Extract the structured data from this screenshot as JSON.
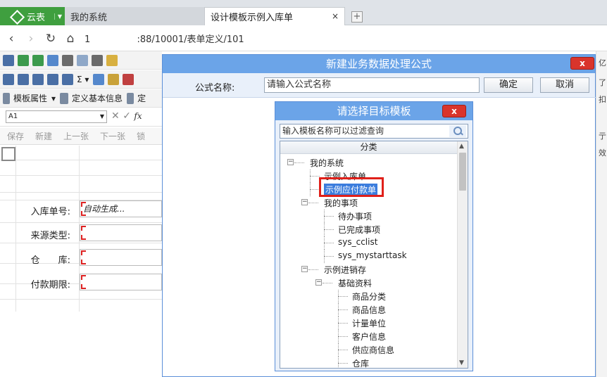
{
  "browser": {
    "brand": "云表",
    "tabs": [
      {
        "label": "我的系统"
      },
      {
        "label": "设计模板示例入库单",
        "close": "×"
      }
    ],
    "newtab": "+",
    "url": "1        :88/10001/表单定义/101"
  },
  "app": {
    "toolbar3": [
      "模板属性",
      "定义基本信息",
      "定"
    ],
    "cellref": "A1",
    "actions": [
      "保存",
      "新建",
      "上一张",
      "下一张",
      "锁"
    ],
    "form": [
      {
        "label": "入库单号:",
        "value": "自动生成..."
      },
      {
        "label": "来源类型:",
        "value": ""
      },
      {
        "label": "仓　　库:",
        "value": ""
      },
      {
        "label": "付款期限:",
        "value": ""
      }
    ],
    "right_strip": [
      "亿",
      "了",
      "扣",
      "亍",
      "效"
    ]
  },
  "dialog": {
    "title": "新建业务数据处理公式",
    "close": "x",
    "name_label": "公式名称:",
    "name_placeholder": "请输入公式名称",
    "ok": "确定",
    "cancel": "取消"
  },
  "picker": {
    "title": "请选择目标模板",
    "close": "x",
    "search_placeholder": "输入模板名称可以过滤查询",
    "column": "分类",
    "tree": [
      {
        "label": "我的系统",
        "depth": 0,
        "toggle": "−"
      },
      {
        "label": "示例入库单",
        "depth": 1
      },
      {
        "label": "示例应付款单",
        "depth": 1,
        "selected": true
      },
      {
        "label": "我的事项",
        "depth": 1,
        "toggle": "−"
      },
      {
        "label": "待办事项",
        "depth": 2
      },
      {
        "label": "已完成事项",
        "depth": 2
      },
      {
        "label": "sys_cclist",
        "depth": 2
      },
      {
        "label": "sys_mystarttask",
        "depth": 2
      },
      {
        "label": "示例进销存",
        "depth": 1,
        "toggle": "−"
      },
      {
        "label": "基础资料",
        "depth": 2,
        "toggle": "−"
      },
      {
        "label": "商品分类",
        "depth": 3
      },
      {
        "label": "商品信息",
        "depth": 3
      },
      {
        "label": "计量单位",
        "depth": 3
      },
      {
        "label": "客户信息",
        "depth": 3
      },
      {
        "label": "供应商信息",
        "depth": 3
      },
      {
        "label": "仓库",
        "depth": 3
      }
    ]
  },
  "colors": {
    "accent": "#6ba4e8",
    "brand": "#3f9f3f",
    "highlight": "#e0201a"
  }
}
